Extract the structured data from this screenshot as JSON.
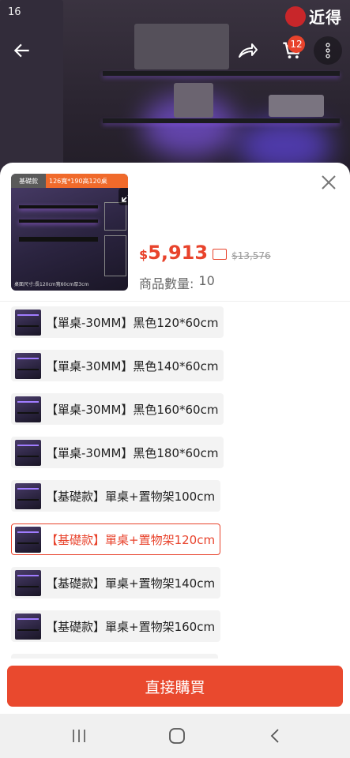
{
  "status_bar": {
    "time": "16"
  },
  "brand": {
    "name": "近得"
  },
  "cart": {
    "count": "12"
  },
  "product": {
    "thumb_tab_left": "基礎款",
    "thumb_tab_right": "126寬*190高120桌",
    "thumb_bottom_note": "桌面尺寸:長120cm寬60cm厚3cm",
    "price_currency": "$",
    "price": "5,913",
    "original_price": "$13,576",
    "quantity_label": "商品數量:",
    "quantity_value": "10"
  },
  "options": [
    {
      "label": "【單桌-30MM】黑色120*60cm",
      "selected": false
    },
    {
      "label": "【單桌-30MM】黑色140*60cm",
      "selected": false
    },
    {
      "label": "【單桌-30MM】黑色160*60cm",
      "selected": false
    },
    {
      "label": "【單桌-30MM】黑色180*60cm",
      "selected": false
    },
    {
      "label": "【基礎款】單桌+置物架100cm",
      "selected": false
    },
    {
      "label": "【基礎款】單桌+置物架120cm",
      "selected": true
    },
    {
      "label": "【基礎款】單桌+置物架140cm",
      "selected": false
    },
    {
      "label": "【基礎款】單桌+置物架160cm",
      "selected": false
    }
  ],
  "actions": {
    "buy_label": "直接購買"
  },
  "colors": {
    "accent": "#e8432c",
    "buy_button": "#e9492e"
  },
  "icons": [
    "back-arrow-icon",
    "share-icon",
    "cart-icon",
    "more-vertical-icon",
    "close-icon",
    "expand-icon",
    "coupon-tag-icon",
    "recent-apps-icon",
    "home-icon",
    "nav-back-icon"
  ]
}
